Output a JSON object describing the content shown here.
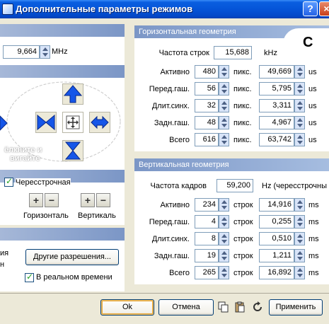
{
  "window": {
    "title": "Дополнительные параметры режимов",
    "help_label": "?",
    "close_label": "×"
  },
  "left": {
    "freq_value": "9,664",
    "freq_unit": "MHz",
    "hint_line1": "ёлкните и",
    "hint_line2": "вигайте",
    "interlaced_label": "Чересстрочная",
    "horizontal_label": "Горизонталь",
    "vertical_label": "Вертикаль",
    "partial_label1": "ия",
    "partial_label2": "н",
    "other_res_button": "Другие разрешения...",
    "realtime_label": "В реальном времени"
  },
  "horizontal": {
    "header": "Горизонтальная геометрия",
    "line_freq_label": "Частота строк",
    "line_freq_value": "15,688",
    "line_freq_unit": "kHz",
    "rows": [
      {
        "label": "Активно",
        "value": "480",
        "unit": "пикс.",
        "time": "49,669",
        "tunit": "us"
      },
      {
        "label": "Перед.гаш.",
        "value": "56",
        "unit": "пикс.",
        "time": "5,795",
        "tunit": "us"
      },
      {
        "label": "Длит.синх.",
        "value": "32",
        "unit": "пикс.",
        "time": "3,311",
        "tunit": "us"
      },
      {
        "label": "Задн.гаш.",
        "value": "48",
        "unit": "пикс.",
        "time": "4,967",
        "tunit": "us"
      },
      {
        "label": "Всего",
        "value": "616",
        "unit": "пикс.",
        "time": "63,742",
        "tunit": "us"
      }
    ]
  },
  "vertical": {
    "header": "Вертикальная геометрия",
    "frame_freq_label": "Частота кадров",
    "frame_freq_value": "59,200",
    "frame_freq_unit": "Hz (чересстрочны",
    "rows": [
      {
        "label": "Активно",
        "value": "234",
        "unit": "строк",
        "time": "14,916",
        "tunit": "ms"
      },
      {
        "label": "Перед.гаш.",
        "value": "4",
        "unit": "строк",
        "time": "0,255",
        "tunit": "ms"
      },
      {
        "label": "Длит.синх.",
        "value": "8",
        "unit": "строк",
        "time": "0,510",
        "tunit": "ms"
      },
      {
        "label": "Задн.гаш.",
        "value": "19",
        "unit": "строк",
        "time": "1,211",
        "tunit": "ms"
      },
      {
        "label": "Всего",
        "value": "265",
        "unit": "строк",
        "time": "16,892",
        "tunit": "ms"
      }
    ]
  },
  "overlay_letter": "C",
  "footer": {
    "ok": "Ok",
    "cancel": "Отмена",
    "apply": "Применить"
  }
}
